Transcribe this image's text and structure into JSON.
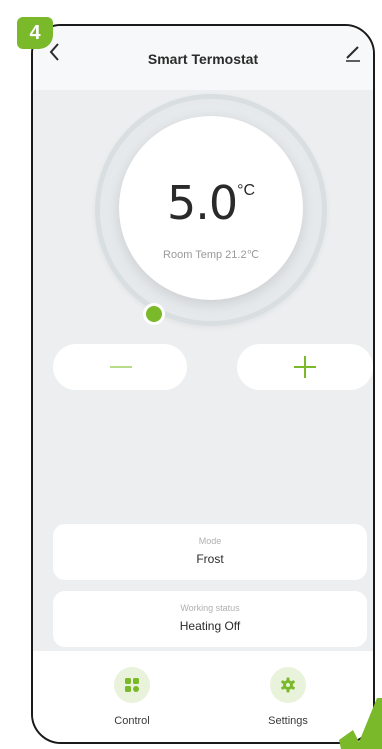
{
  "step_badge": "4",
  "header": {
    "title": "Smart Termostat"
  },
  "dial": {
    "set_temperature": "5.0",
    "unit": "°C",
    "room_temp_text": "Room Temp 21.2℃"
  },
  "mode": {
    "label": "Mode",
    "value": "Frost"
  },
  "working_status": {
    "label": "Working status",
    "value": "Heating Off"
  },
  "bottom_nav": {
    "items": [
      {
        "label": "Control",
        "icon": "grid-icon"
      },
      {
        "label": "Settings",
        "icon": "gear-icon"
      }
    ]
  },
  "colors": {
    "accent": "#7ab929",
    "background": "#eceef0",
    "card": "#ffffff"
  }
}
